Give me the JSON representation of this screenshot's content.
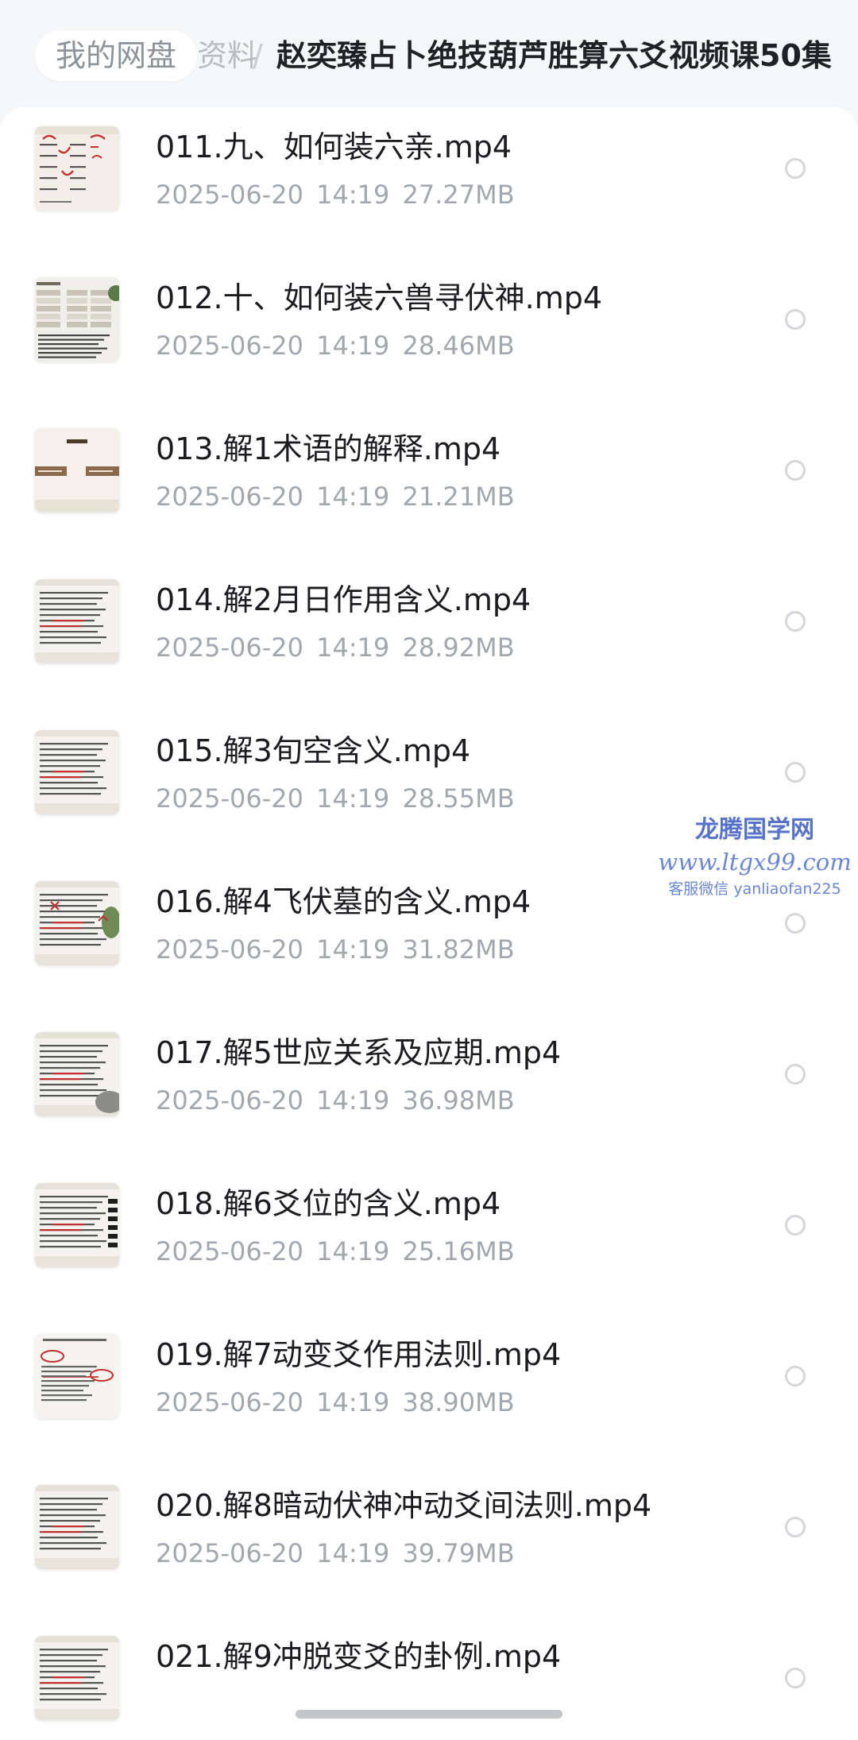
{
  "breadcrumb": {
    "root": "我的网盘",
    "middle": "资料",
    "separator": "/",
    "current": "赵奕臻占卜绝技葫芦胜算六爻视频课50集"
  },
  "files": [
    {
      "name": "011.九、如何装六亲.mp4",
      "date": "2025-06-20",
      "time": "14:19",
      "size": "27.27MB",
      "thumb": "handwritten"
    },
    {
      "name": "012.十、如何装六兽寻伏神.mp4",
      "date": "2025-06-20",
      "time": "14:19",
      "size": "28.46MB",
      "thumb": "table"
    },
    {
      "name": "013.解1术语的解释.mp4",
      "date": "2025-06-20",
      "time": "14:19",
      "size": "21.21MB",
      "thumb": "contents"
    },
    {
      "name": "014.解2月日作用含义.mp4",
      "date": "2025-06-20",
      "time": "14:19",
      "size": "28.92MB",
      "thumb": "text"
    },
    {
      "name": "015.解3旬空含义.mp4",
      "date": "2025-06-20",
      "time": "14:19",
      "size": "28.55MB",
      "thumb": "text"
    },
    {
      "name": "016.解4飞伏墓的含义.mp4",
      "date": "2025-06-20",
      "time": "14:19",
      "size": "31.82MB",
      "thumb": "text-plant"
    },
    {
      "name": "017.解5世应关系及应期.mp4",
      "date": "2025-06-20",
      "time": "14:19",
      "size": "36.98MB",
      "thumb": "text-stone"
    },
    {
      "name": "018.解6爻位的含义.mp4",
      "date": "2025-06-20",
      "time": "14:19",
      "size": "25.16MB",
      "thumb": "text-bars"
    },
    {
      "name": "019.解7动变爻作用法则.mp4",
      "date": "2025-06-20",
      "time": "14:19",
      "size": "38.90MB",
      "thumb": "diagram"
    },
    {
      "name": "020.解8暗动伏神冲动爻间法则.mp4",
      "date": "2025-06-20",
      "time": "14:19",
      "size": "39.79MB",
      "thumb": "text"
    },
    {
      "name": "021.解9冲脱变爻的卦例.mp4",
      "date": "",
      "time": "",
      "size": "",
      "thumb": "text"
    }
  ],
  "watermark": {
    "title": "龙腾国学网",
    "url": "www.ltgx99.com",
    "contact": "客服微信 yanliaofan225"
  },
  "colors": {
    "background": "#f6f7f9",
    "primary_text": "#1a1c20",
    "secondary_text": "#a3a7ae",
    "watermark": "#5673c9"
  }
}
